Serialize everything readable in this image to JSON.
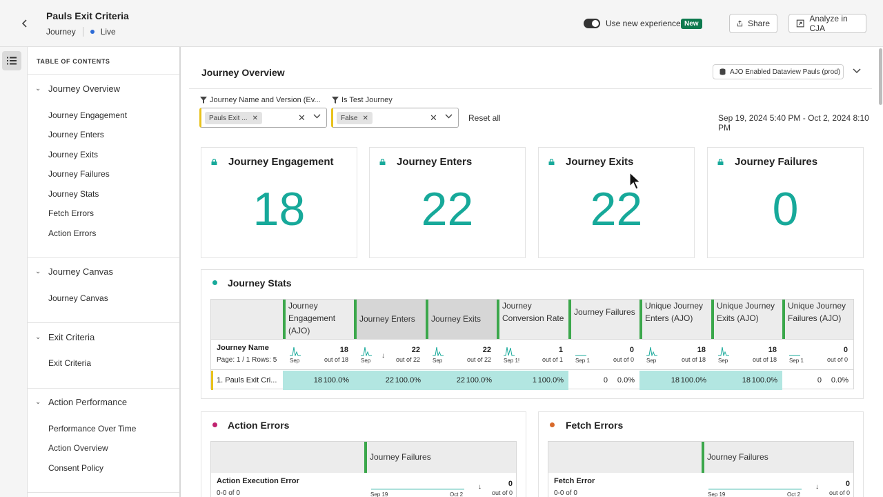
{
  "header": {
    "title": "Pauls Exit Criteria",
    "type": "Journey",
    "status": "Live",
    "toggle_label": "Use new experience",
    "new_badge": "New",
    "share_label": "Share",
    "cja_label": "Analyze in CJA"
  },
  "toc": {
    "title": "TABLE OF CONTENTS",
    "sections": [
      {
        "label": "Journey Overview",
        "items": [
          "Journey Engagement",
          "Journey Enters",
          "Journey Exits",
          "Journey Failures",
          "Journey Stats",
          "Fetch Errors",
          "Action Errors"
        ]
      },
      {
        "label": "Journey Canvas",
        "items": [
          "Journey Canvas"
        ]
      },
      {
        "label": "Exit Criteria",
        "items": [
          "Exit Criteria"
        ]
      },
      {
        "label": "Action Performance",
        "items": [
          "Performance Over Time",
          "Action Overview",
          "Consent Policy"
        ]
      }
    ]
  },
  "main": {
    "title": "Journey Overview",
    "dataview": "AJO Enabled Dataview Pauls (prod)",
    "filters": [
      {
        "label": "Journey Name and Version (Ev...",
        "chip": "Pauls Exit ..."
      },
      {
        "label": "Is Test Journey",
        "chip": "False"
      }
    ],
    "reset_all": "Reset all",
    "date_range": "Sep 19, 2024 5:40 PM - Oct 2, 2024 8:10 PM",
    "kpis": [
      {
        "title": "Journey Engagement",
        "value": "18"
      },
      {
        "title": "Journey Enters",
        "value": "22"
      },
      {
        "title": "Journey Exits",
        "value": "22"
      },
      {
        "title": "Journey Failures",
        "value": "0"
      }
    ]
  },
  "stats": {
    "title": "Journey Stats",
    "row_header": "Journey Name",
    "page_info": "Page: 1 / 1 Rows: 5",
    "columns": [
      {
        "label": "Journey Engagement (AJO)",
        "total": "18",
        "out_of": "out of 18",
        "spark_label": "Sep",
        "row_value": "18",
        "row_pct": "100.0%"
      },
      {
        "label": "Journey Enters",
        "total": "22",
        "out_of": "out of 22",
        "spark_label": "Sep",
        "row_value": "22",
        "row_pct": "100.0%"
      },
      {
        "label": "Journey Exits",
        "total": "22",
        "out_of": "out of 22",
        "spark_label": "Sep",
        "row_value": "22",
        "row_pct": "100.0%"
      },
      {
        "label": "Journey Conversion Rate",
        "total": "1",
        "out_of": "out of 1",
        "spark_label": "Sep 1!",
        "row_value": "1",
        "row_pct": "100.0%"
      },
      {
        "label": "Journey Failures",
        "total": "0",
        "out_of": "out of 0",
        "spark_label": "Sep 1",
        "row_value": "0",
        "row_pct": "0.0%"
      },
      {
        "label": "Unique Journey Enters (AJO)",
        "total": "18",
        "out_of": "out of 18",
        "spark_label": "Sep",
        "row_value": "18",
        "row_pct": "100.0%"
      },
      {
        "label": "Unique Journey Exits (AJO)",
        "total": "18",
        "out_of": "out of 18",
        "spark_label": "Sep",
        "row_value": "18",
        "row_pct": "100.0%"
      },
      {
        "label": "Unique Journey Failures (AJO)",
        "total": "0",
        "out_of": "out of 0",
        "spark_label": "Sep 1",
        "row_value": "0",
        "row_pct": "0.0%"
      }
    ],
    "row": {
      "name": "1.  Pauls Exit Cri..."
    }
  },
  "action_errors": {
    "title": "Action Errors",
    "column": "Journey Failures",
    "row_header": "Action Execution Error",
    "row_sub": "0-0 of 0",
    "start": "Sep 19",
    "end": "Oct 2",
    "total": "0",
    "out_of": "out of 0"
  },
  "fetch_errors": {
    "title": "Fetch Errors",
    "column": "Journey Failures",
    "row_header": "Fetch Error",
    "row_sub": "0-0 of 0",
    "start": "Sep 19",
    "end": "Oct 2",
    "total": "0",
    "out_of": "out of 0"
  },
  "colors": {
    "accent_teal": "#17a99a",
    "highlight": "#b2e6e1",
    "green_bar": "#3ba74b",
    "filter_yellow": "#e8c21c",
    "action_dot": "#c0226f",
    "fetch_dot": "#d8692a",
    "stats_dot": "#17a99a",
    "live_dot": "#2d6bd6"
  },
  "icons": [
    "back-arrow-icon",
    "share-icon",
    "analyze-icon",
    "toc-list-icon",
    "chevron-down-icon",
    "lock-icon",
    "filter-icon",
    "close-icon",
    "dataview-icon",
    "sparkline-icon",
    "sort-down-icon",
    "cursor-icon"
  ]
}
